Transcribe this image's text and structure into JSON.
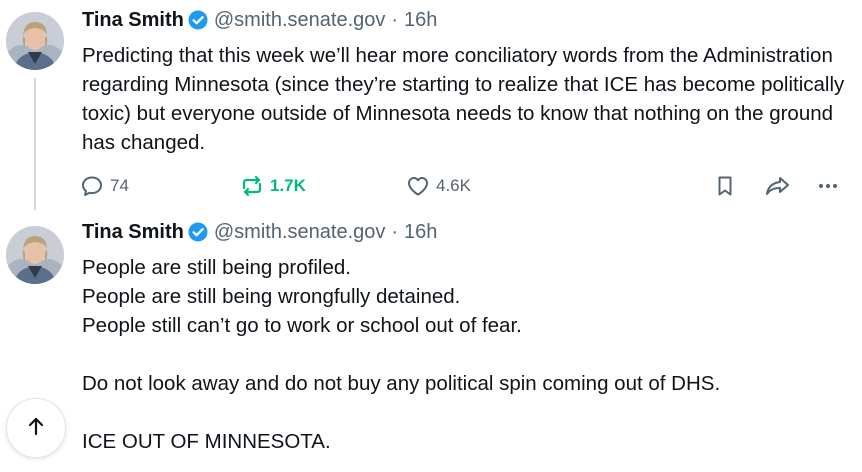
{
  "colors": {
    "text": "#0f1419",
    "secondary": "#536471",
    "repost_active": "#00ba7c",
    "verified": "#1d9bf0",
    "thread_line": "#cfd9de"
  },
  "posts": [
    {
      "author": {
        "name": "Tina Smith",
        "handle": "@smith.senate.gov",
        "separator": "·",
        "time": "16h",
        "avatar_icon": "avatar-photo",
        "verified_icon": "verified-badge-icon"
      },
      "text": "Predicting that this week we’ll hear more conciliatory words from the Administration regarding Minnesota (since they’re starting to realize that ICE has become politically toxic) but everyone outside of Minnesota needs to know that nothing on the ground has changed.",
      "actions": {
        "replies": "74",
        "reposts": "1.7K",
        "likes": "4.6K"
      }
    },
    {
      "author": {
        "name": "Tina Smith",
        "handle": "@smith.senate.gov",
        "separator": "·",
        "time": "16h",
        "avatar_icon": "avatar-photo",
        "verified_icon": "verified-badge-icon"
      },
      "text": "People are still being profiled.\nPeople are still being wrongfully detained.\nPeople still can’t go to work or school out of fear.\n\nDo not look away and do not buy any political spin coming out of DHS.\n\nICE OUT OF MINNESOTA."
    }
  ],
  "scroll_top_icon": "arrow-up-icon"
}
